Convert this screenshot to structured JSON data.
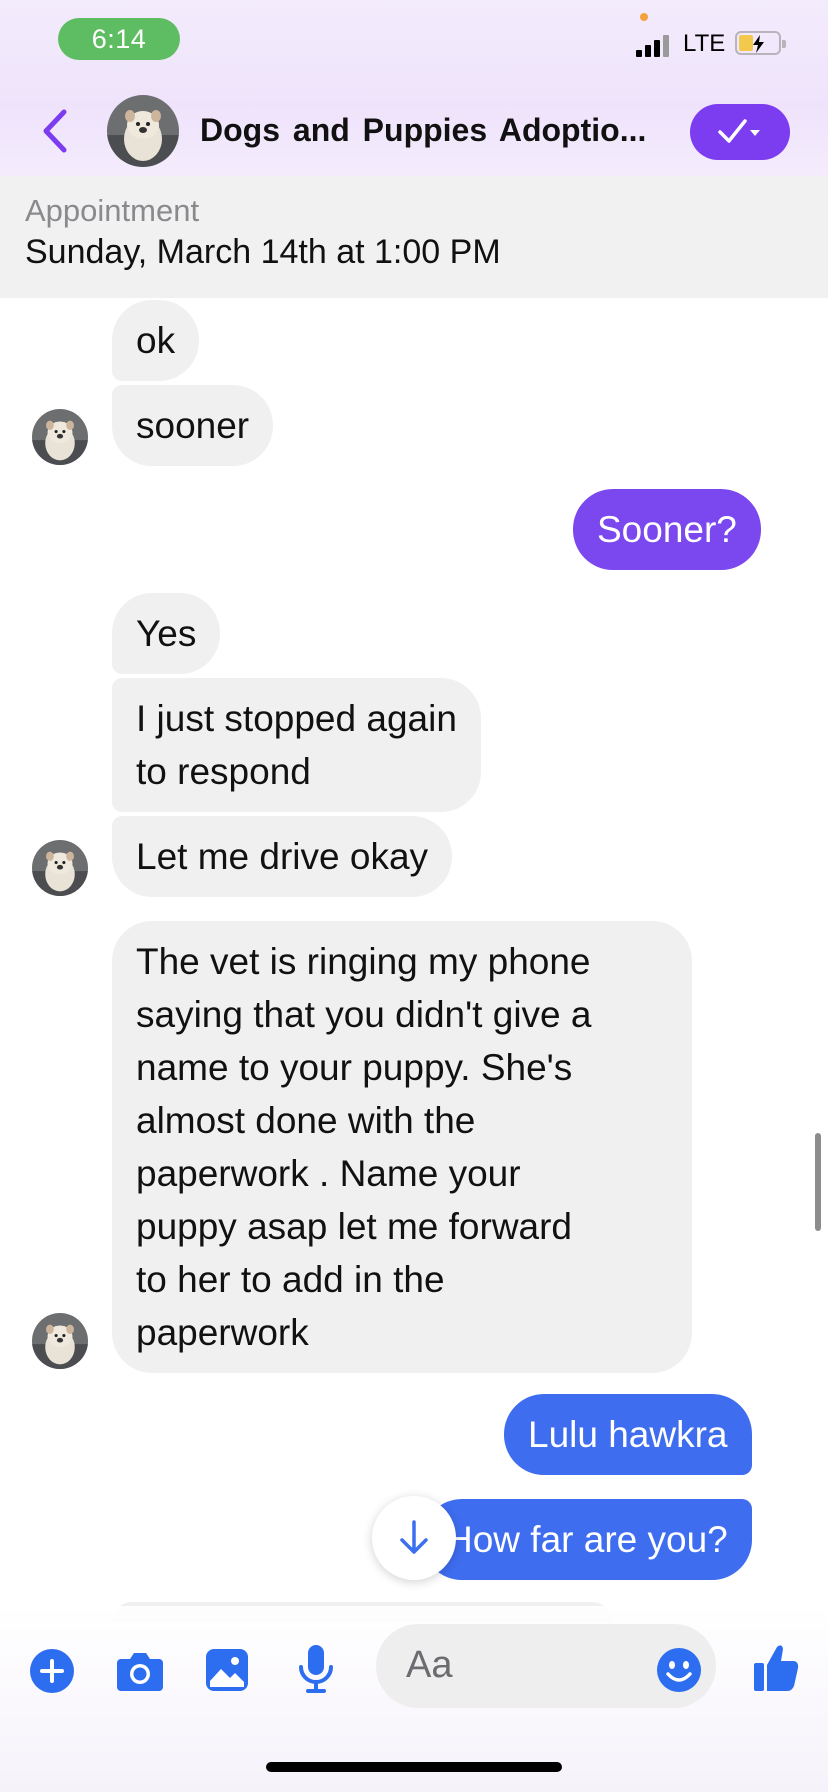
{
  "status_bar": {
    "time": "6:14",
    "network": "LTE"
  },
  "header": {
    "title": "Dogs  and Puppies  Adoptio...",
    "back_icon": "chevron-left-icon",
    "verify_icon": "check-dropdown-icon",
    "accent_color": "#7c3cf0"
  },
  "appointment": {
    "label": "Appointment",
    "date": "Sunday, March 14th at 1:00 PM"
  },
  "messages": [
    {
      "direction": "in",
      "text": "ok"
    },
    {
      "direction": "in",
      "text": "sooner"
    },
    {
      "direction": "out",
      "text": "Sooner?",
      "color": "#7b47ee"
    },
    {
      "direction": "in",
      "text": "Yes"
    },
    {
      "direction": "in",
      "lines": [
        "I just stopped again",
        "to respond"
      ]
    },
    {
      "direction": "in",
      "text": "Let me drive okay"
    },
    {
      "direction": "in",
      "lines": [
        "The vet is ringing my phone",
        "saying that you didn't give a",
        "name to your puppy. She's",
        "almost done with the",
        "paperwork . Name your",
        "puppy asap let me forward",
        "to her to add in the",
        "paperwork"
      ]
    },
    {
      "direction": "out",
      "text": "Lulu hawkra",
      "color": "#3f6df0"
    },
    {
      "direction": "out",
      "text": "How far are you?",
      "color": "#3f6df0"
    }
  ],
  "composer": {
    "placeholder": "Aa",
    "icons": [
      "plus-icon",
      "camera-icon",
      "image-icon",
      "microphone-icon",
      "emoji-icon",
      "thumbs-up-icon"
    ],
    "accent_color": "#2d6df0"
  }
}
